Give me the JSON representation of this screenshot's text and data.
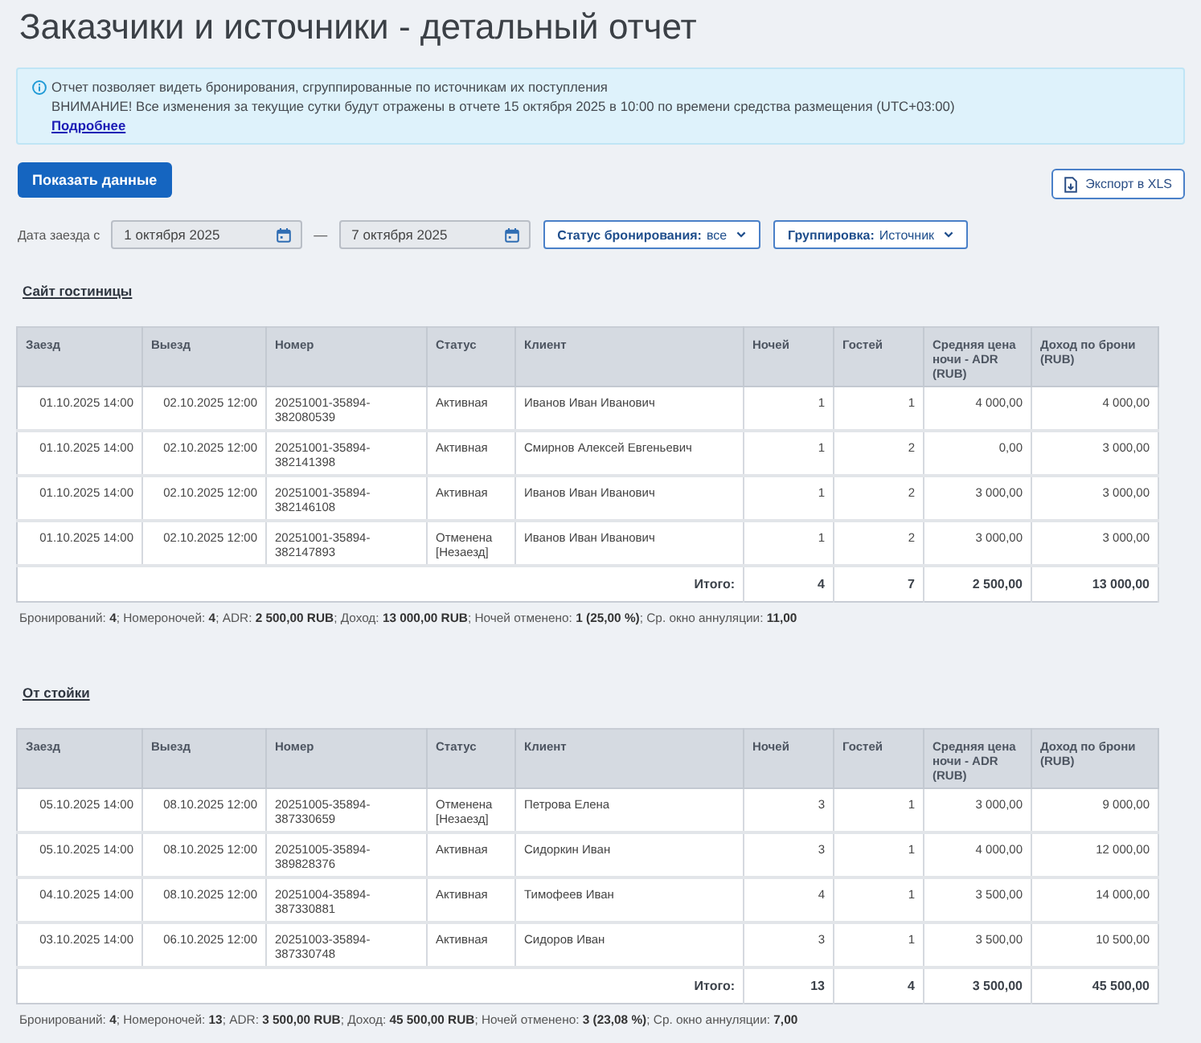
{
  "page_title": "Заказчики и источники - детальный отчет",
  "info_banner": {
    "lines": [
      "Отчет позволяет видеть бронирования, сгруппированные по источникам их поступления",
      "ВНИМАНИЕ! Все изменения за текущие сутки будут отражены в отчете 15 октября 2025 в 10:00 по времени средства размещения (UTC+03:00)"
    ],
    "link": "Подробнее"
  },
  "actions": {
    "show_button": "Показать данные",
    "export_button": "Экспорт в XLS"
  },
  "filters": {
    "date_label": "Дата заезда с",
    "date_from": "1 октября 2025",
    "separator": "—",
    "date_to": "7 октября 2025",
    "dropdowns": [
      {
        "label": "Статус бронирования:",
        "value": "все"
      },
      {
        "label": "Группировка:",
        "value": "Источник"
      }
    ]
  },
  "sections": [
    {
      "title": "Сайт гостиницы",
      "table": {
        "columns": [
          "Заезд",
          "Выезд",
          "Номер",
          "Статус",
          "Клиент",
          "Ночей",
          "Гостей",
          "Средняя цена ночи - ADR (RUB)",
          "Доход по брони (RUB)"
        ],
        "rows": [
          [
            "01.10.2025 14:00",
            "02.10.2025 12:00",
            "20251001-35894-382080539",
            "Активная",
            "Иванов Иван Иванович",
            "1",
            "1",
            "4 000,00",
            "4 000,00"
          ],
          [
            "01.10.2025 14:00",
            "02.10.2025 12:00",
            "20251001-35894-382141398",
            "Активная",
            "Смирнов Алексей Евгеньевич",
            "1",
            "2",
            "0,00",
            "3 000,00"
          ],
          [
            "01.10.2025 14:00",
            "02.10.2025 12:00",
            "20251001-35894-382146108",
            "Активная",
            "Иванов Иван Иванович",
            "1",
            "2",
            "3 000,00",
            "3 000,00"
          ],
          [
            "01.10.2025 14:00",
            "02.10.2025 12:00",
            "20251001-35894-382147893",
            "Отменена [Незаезд]",
            "Иванов Иван Иванович",
            "1",
            "2",
            "3 000,00",
            "3 000,00"
          ]
        ],
        "totals": {
          "label": "Итого:",
          "values": [
            "4",
            "7",
            "2 500,00",
            "13 000,00"
          ]
        }
      },
      "summary": "Бронирований: **4**; Номероночей: **4**; ADR: **2 500,00 RUB**; Доход: **13 000,00 RUB**; Ночей отменено: **1 (25,00 %)**; Ср. окно аннуляции: **11,00**"
    },
    {
      "title": "От стойки",
      "table": {
        "columns": [
          "Заезд",
          "Выезд",
          "Номер",
          "Статус",
          "Клиент",
          "Ночей",
          "Гостей",
          "Средняя цена ночи - ADR (RUB)",
          "Доход по брони (RUB)"
        ],
        "rows": [
          [
            "05.10.2025 14:00",
            "08.10.2025 12:00",
            "20251005-35894-387330659",
            "Отменена [Незаезд]",
            "Петрова Елена",
            "3",
            "1",
            "3 000,00",
            "9 000,00"
          ],
          [
            "05.10.2025 14:00",
            "08.10.2025 12:00",
            "20251005-35894-389828376",
            "Активная",
            "Сидоркин Иван",
            "3",
            "1",
            "4 000,00",
            "12 000,00"
          ],
          [
            "04.10.2025 14:00",
            "08.10.2025 12:00",
            "20251004-35894-387330881",
            "Активная",
            "Тимофеев Иван",
            "4",
            "1",
            "3 500,00",
            "14 000,00"
          ],
          [
            "03.10.2025 14:00",
            "06.10.2025 12:00",
            "20251003-35894-387330748",
            "Активная",
            "Сидоров Иван",
            "3",
            "1",
            "3 500,00",
            "10 500,00"
          ]
        ],
        "totals": {
          "label": "Итого:",
          "values": [
            "13",
            "4",
            "3 500,00",
            "45 500,00"
          ]
        }
      },
      "summary": "Бронирований: **4**; Номероночей: **13**; ADR: **3 500,00 RUB**; Доход: **45 500,00 RUB**; Ночей отменено: **3 (23,08 %)**; Ср. окно аннуляции: **7,00**"
    }
  ]
}
